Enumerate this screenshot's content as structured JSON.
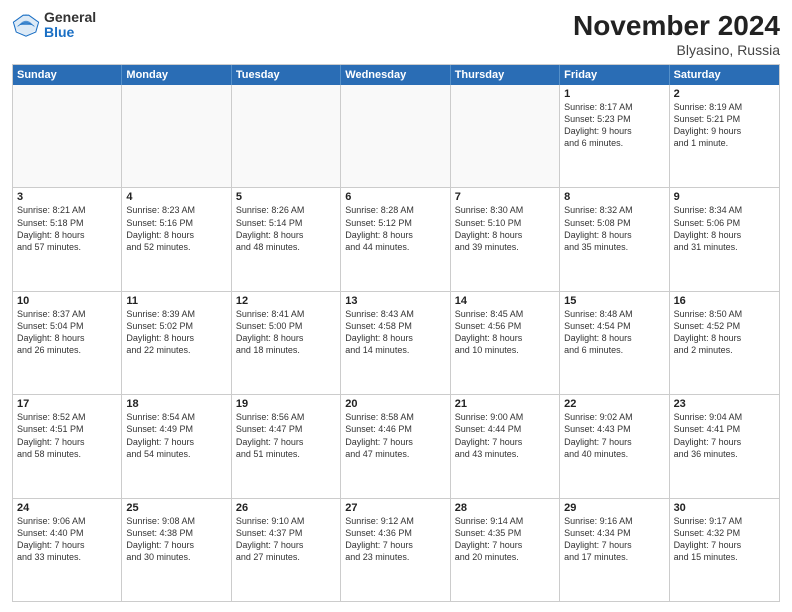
{
  "logo": {
    "general": "General",
    "blue": "Blue"
  },
  "title": "November 2024",
  "location": "Blyasino, Russia",
  "header_days": [
    "Sunday",
    "Monday",
    "Tuesday",
    "Wednesday",
    "Thursday",
    "Friday",
    "Saturday"
  ],
  "rows": [
    [
      {
        "day": "",
        "info": "",
        "empty": true
      },
      {
        "day": "",
        "info": "",
        "empty": true
      },
      {
        "day": "",
        "info": "",
        "empty": true
      },
      {
        "day": "",
        "info": "",
        "empty": true
      },
      {
        "day": "",
        "info": "",
        "empty": true
      },
      {
        "day": "1",
        "info": "Sunrise: 8:17 AM\nSunset: 5:23 PM\nDaylight: 9 hours\nand 6 minutes."
      },
      {
        "day": "2",
        "info": "Sunrise: 8:19 AM\nSunset: 5:21 PM\nDaylight: 9 hours\nand 1 minute."
      }
    ],
    [
      {
        "day": "3",
        "info": "Sunrise: 8:21 AM\nSunset: 5:18 PM\nDaylight: 8 hours\nand 57 minutes."
      },
      {
        "day": "4",
        "info": "Sunrise: 8:23 AM\nSunset: 5:16 PM\nDaylight: 8 hours\nand 52 minutes."
      },
      {
        "day": "5",
        "info": "Sunrise: 8:26 AM\nSunset: 5:14 PM\nDaylight: 8 hours\nand 48 minutes."
      },
      {
        "day": "6",
        "info": "Sunrise: 8:28 AM\nSunset: 5:12 PM\nDaylight: 8 hours\nand 44 minutes."
      },
      {
        "day": "7",
        "info": "Sunrise: 8:30 AM\nSunset: 5:10 PM\nDaylight: 8 hours\nand 39 minutes."
      },
      {
        "day": "8",
        "info": "Sunrise: 8:32 AM\nSunset: 5:08 PM\nDaylight: 8 hours\nand 35 minutes."
      },
      {
        "day": "9",
        "info": "Sunrise: 8:34 AM\nSunset: 5:06 PM\nDaylight: 8 hours\nand 31 minutes."
      }
    ],
    [
      {
        "day": "10",
        "info": "Sunrise: 8:37 AM\nSunset: 5:04 PM\nDaylight: 8 hours\nand 26 minutes."
      },
      {
        "day": "11",
        "info": "Sunrise: 8:39 AM\nSunset: 5:02 PM\nDaylight: 8 hours\nand 22 minutes."
      },
      {
        "day": "12",
        "info": "Sunrise: 8:41 AM\nSunset: 5:00 PM\nDaylight: 8 hours\nand 18 minutes."
      },
      {
        "day": "13",
        "info": "Sunrise: 8:43 AM\nSunset: 4:58 PM\nDaylight: 8 hours\nand 14 minutes."
      },
      {
        "day": "14",
        "info": "Sunrise: 8:45 AM\nSunset: 4:56 PM\nDaylight: 8 hours\nand 10 minutes."
      },
      {
        "day": "15",
        "info": "Sunrise: 8:48 AM\nSunset: 4:54 PM\nDaylight: 8 hours\nand 6 minutes."
      },
      {
        "day": "16",
        "info": "Sunrise: 8:50 AM\nSunset: 4:52 PM\nDaylight: 8 hours\nand 2 minutes."
      }
    ],
    [
      {
        "day": "17",
        "info": "Sunrise: 8:52 AM\nSunset: 4:51 PM\nDaylight: 7 hours\nand 58 minutes."
      },
      {
        "day": "18",
        "info": "Sunrise: 8:54 AM\nSunset: 4:49 PM\nDaylight: 7 hours\nand 54 minutes."
      },
      {
        "day": "19",
        "info": "Sunrise: 8:56 AM\nSunset: 4:47 PM\nDaylight: 7 hours\nand 51 minutes."
      },
      {
        "day": "20",
        "info": "Sunrise: 8:58 AM\nSunset: 4:46 PM\nDaylight: 7 hours\nand 47 minutes."
      },
      {
        "day": "21",
        "info": "Sunrise: 9:00 AM\nSunset: 4:44 PM\nDaylight: 7 hours\nand 43 minutes."
      },
      {
        "day": "22",
        "info": "Sunrise: 9:02 AM\nSunset: 4:43 PM\nDaylight: 7 hours\nand 40 minutes."
      },
      {
        "day": "23",
        "info": "Sunrise: 9:04 AM\nSunset: 4:41 PM\nDaylight: 7 hours\nand 36 minutes."
      }
    ],
    [
      {
        "day": "24",
        "info": "Sunrise: 9:06 AM\nSunset: 4:40 PM\nDaylight: 7 hours\nand 33 minutes."
      },
      {
        "day": "25",
        "info": "Sunrise: 9:08 AM\nSunset: 4:38 PM\nDaylight: 7 hours\nand 30 minutes."
      },
      {
        "day": "26",
        "info": "Sunrise: 9:10 AM\nSunset: 4:37 PM\nDaylight: 7 hours\nand 27 minutes."
      },
      {
        "day": "27",
        "info": "Sunrise: 9:12 AM\nSunset: 4:36 PM\nDaylight: 7 hours\nand 23 minutes."
      },
      {
        "day": "28",
        "info": "Sunrise: 9:14 AM\nSunset: 4:35 PM\nDaylight: 7 hours\nand 20 minutes."
      },
      {
        "day": "29",
        "info": "Sunrise: 9:16 AM\nSunset: 4:34 PM\nDaylight: 7 hours\nand 17 minutes."
      },
      {
        "day": "30",
        "info": "Sunrise: 9:17 AM\nSunset: 4:32 PM\nDaylight: 7 hours\nand 15 minutes."
      }
    ]
  ]
}
